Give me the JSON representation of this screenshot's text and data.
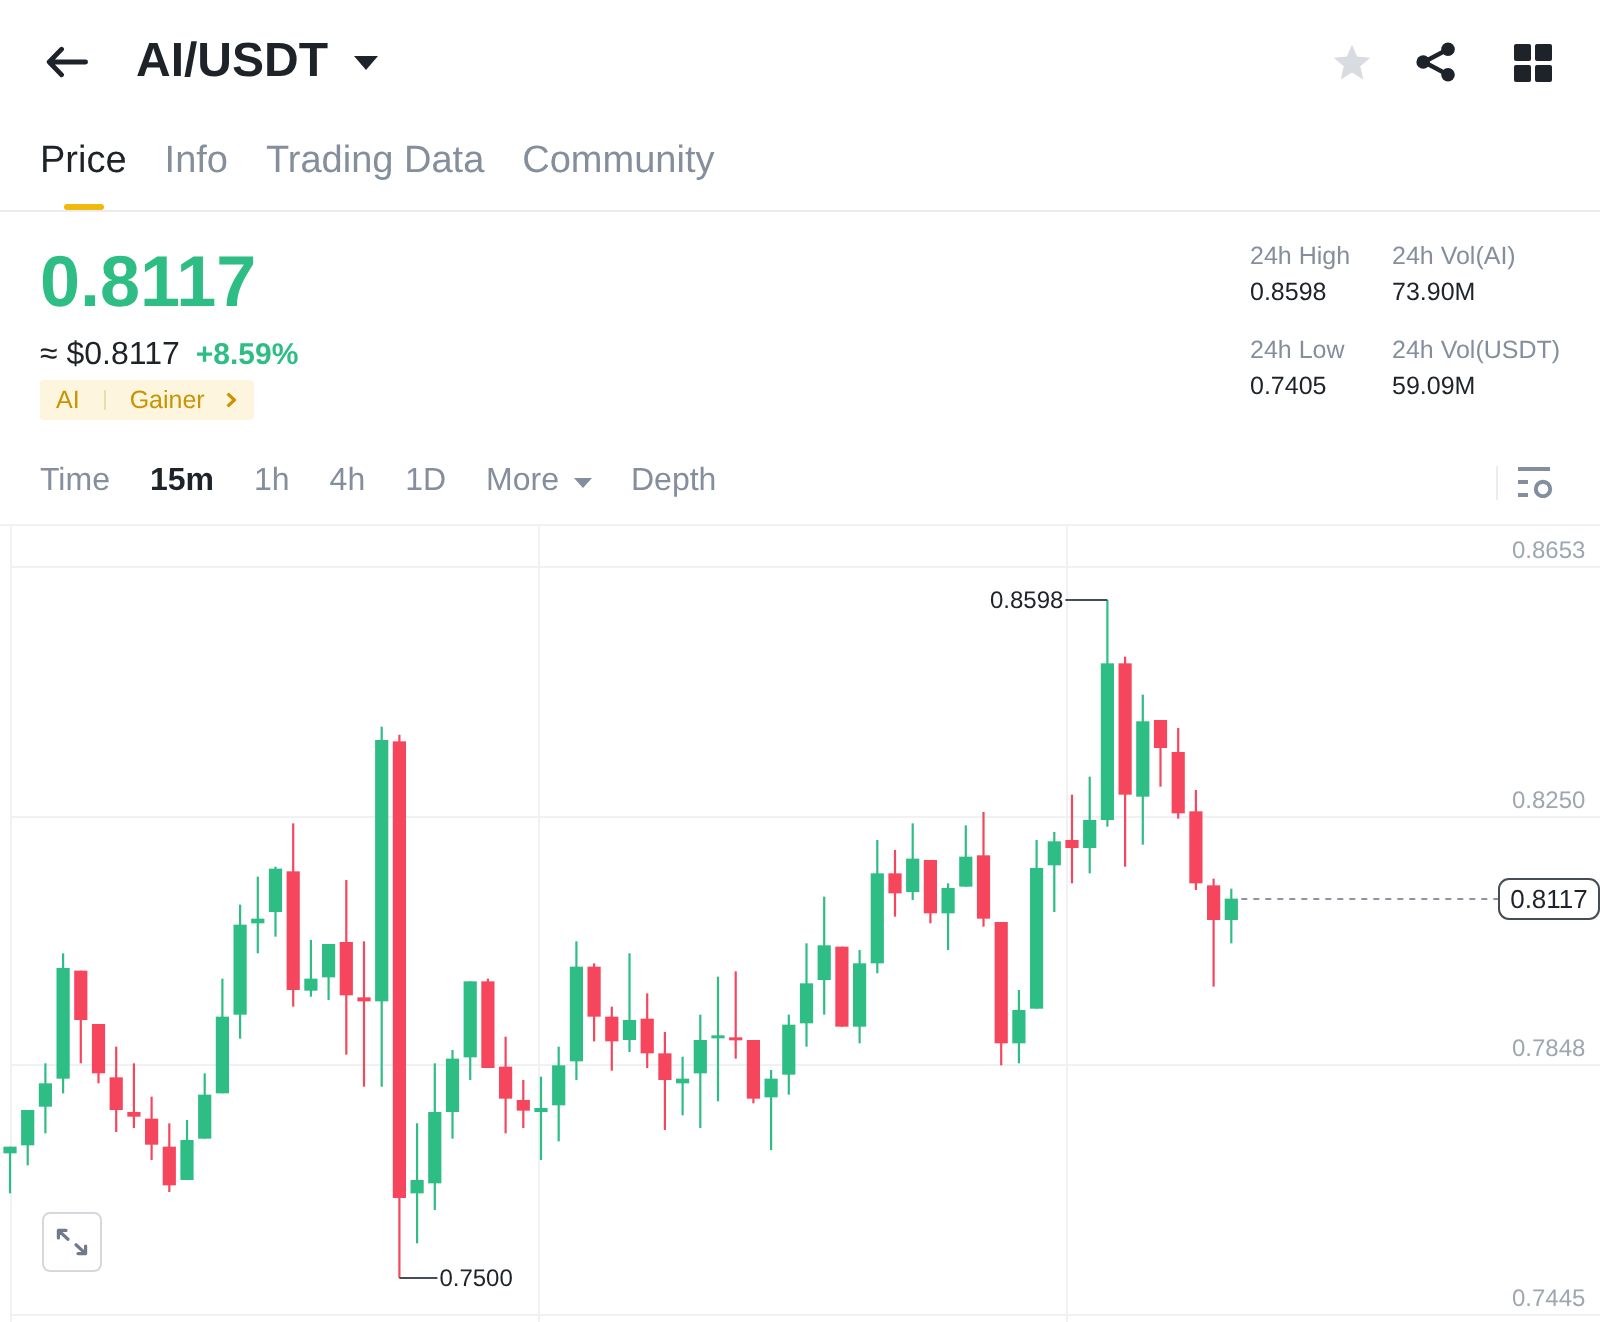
{
  "header": {
    "title": "AI/USDT",
    "favorited": false
  },
  "tabs": [
    {
      "label": "Price",
      "selected": true
    },
    {
      "label": "Info",
      "selected": false
    },
    {
      "label": "Trading Data",
      "selected": false
    },
    {
      "label": "Community",
      "selected": false
    }
  ],
  "ticker": {
    "last_price": "0.8117",
    "rising": true,
    "approx_price": "≈ $0.8117",
    "change": "+8.59%",
    "tags": [
      {
        "label": "AI"
      },
      {
        "label": "Gainer"
      }
    ]
  },
  "stats": [
    {
      "label": "24h High",
      "value": "0.8598"
    },
    {
      "label": "24h Vol(AI)",
      "value": "73.90M"
    },
    {
      "label": "24h Low",
      "value": "0.7405"
    },
    {
      "label": "24h Vol(USDT)",
      "value": "59.09M"
    }
  ],
  "intervals": [
    {
      "label": "Time",
      "kind": "option",
      "selected": false
    },
    {
      "label": "15m",
      "kind": "option",
      "selected": true
    },
    {
      "label": "1h",
      "kind": "option",
      "selected": false
    },
    {
      "label": "4h",
      "kind": "option",
      "selected": false
    },
    {
      "label": "1D",
      "kind": "option",
      "selected": false
    },
    {
      "label": "More",
      "kind": "dropdown",
      "selected": false
    },
    {
      "label": "Depth",
      "kind": "option",
      "selected": false
    }
  ],
  "chart": {
    "axis_labels": [
      "0.8653",
      "0.8250",
      "0.7848",
      "0.7445"
    ],
    "high_label": "0.8598",
    "low_label": "0.7500",
    "last_price_tag": "0.8117"
  }
}
